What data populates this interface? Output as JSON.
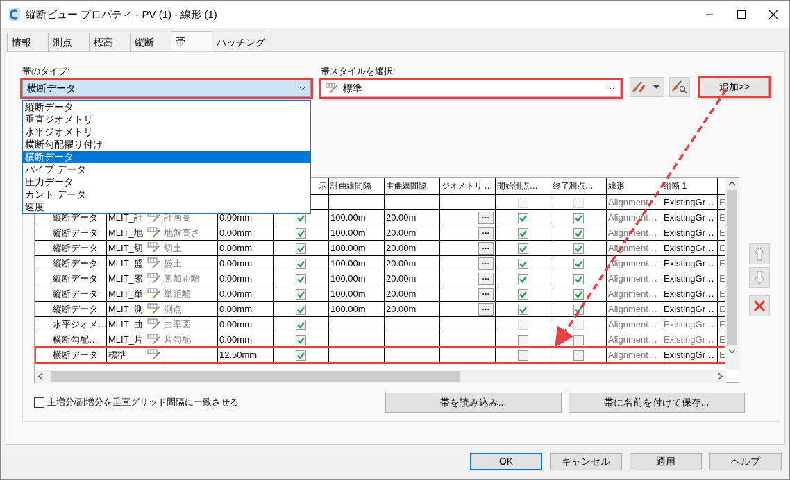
{
  "window": {
    "title": "縦断ビュー プロパティ - PV (1) - 線形 (1)"
  },
  "tabs": [
    {
      "label": "情報",
      "selected": false
    },
    {
      "label": "測点",
      "selected": false
    },
    {
      "label": "標高",
      "selected": false
    },
    {
      "label": "縦断",
      "selected": false
    },
    {
      "label": "帯",
      "selected": true
    },
    {
      "label": "ハッチング",
      "selected": false
    }
  ],
  "band_type": {
    "label": "帯のタイプ:",
    "value": "横断データ",
    "highlighted": true,
    "expanded": true,
    "options": [
      {
        "label": "縦断データ",
        "selected": false
      },
      {
        "label": "垂直ジオメトリ",
        "selected": false
      },
      {
        "label": "水平ジオメトリ",
        "selected": false
      },
      {
        "label": "横断勾配擢り付け",
        "selected": false
      },
      {
        "label": "横断データ",
        "selected": true
      },
      {
        "label": "パイプ データ",
        "selected": false
      },
      {
        "label": "圧力データ",
        "selected": false
      },
      {
        "label": "カント データ",
        "selected": false
      },
      {
        "label": "速度",
        "selected": false
      }
    ]
  },
  "band_style": {
    "label": "帯スタイルを選択:",
    "value": "標準",
    "highlighted": true
  },
  "add_button": {
    "label": "追加>>",
    "highlighted": true
  },
  "table": {
    "visible_columns": [
      "示",
      "計曲線間隔",
      "主曲線間隔",
      "ジオメトリ …",
      "開始測点…",
      "終了測点…",
      "線形",
      "縦断 1"
    ],
    "rows": [
      {
        "highlighted": false,
        "start": {
          "checked": false,
          "disabled": true
        },
        "end": {
          "checked": false,
          "disabled": true
        },
        "alignment": "Alignment…",
        "profile_1": "ExistingGr…",
        "profile_1_disabled": false,
        "column_13": "E"
      },
      {
        "highlighted": false,
        "type": "縦断データ",
        "style": "MLIT_計",
        "description": "計画高",
        "offset": "0.00mm",
        "visible": true,
        "major": "100.00m",
        "minor": "20.00m",
        "geometry_button": "···",
        "start": {
          "checked": true,
          "disabled": false
        },
        "end": {
          "checked": true,
          "disabled": false
        },
        "alignment": "Alignment…",
        "profile_1": "ExistingGr…",
        "profile_1_disabled": false,
        "column_13": "E"
      },
      {
        "highlighted": false,
        "type": "縦断データ",
        "style": "MLIT_地",
        "description": "地盤高さ",
        "offset": "0.00mm",
        "visible": true,
        "major": "100.00m",
        "minor": "20.00m",
        "geometry_button": "···",
        "start": {
          "checked": true,
          "disabled": false
        },
        "end": {
          "checked": true,
          "disabled": false
        },
        "alignment": "Alignment…",
        "profile_1": "ExistingGr…",
        "profile_1_disabled": false,
        "column_13": "E"
      },
      {
        "highlighted": false,
        "type": "縦断データ",
        "style": "MLIT_切",
        "description": "切土",
        "offset": "0.00mm",
        "visible": true,
        "major": "100.00m",
        "minor": "20.00m",
        "geometry_button": "···",
        "start": {
          "checked": true,
          "disabled": false
        },
        "end": {
          "checked": true,
          "disabled": false
        },
        "alignment": "Alignment…",
        "profile_1": "ExistingGr…",
        "profile_1_disabled": false,
        "column_13": "E"
      },
      {
        "highlighted": false,
        "type": "縦断データ",
        "style": "MLIT_盛",
        "description": "盛土",
        "offset": "0.00mm",
        "visible": true,
        "major": "100.00m",
        "minor": "20.00m",
        "geometry_button": "···",
        "start": {
          "checked": true,
          "disabled": false
        },
        "end": {
          "checked": true,
          "disabled": false
        },
        "alignment": "Alignment…",
        "profile_1": "ExistingGr…",
        "profile_1_disabled": false,
        "column_13": "E"
      },
      {
        "highlighted": false,
        "type": "縦断データ",
        "style": "MLIT_累",
        "description": "累加距離",
        "offset": "0.00mm",
        "visible": true,
        "major": "100.00m",
        "minor": "20.00m",
        "geometry_button": "···",
        "start": {
          "checked": true,
          "disabled": false
        },
        "end": {
          "checked": true,
          "disabled": false
        },
        "alignment": "Alignment…",
        "profile_1": "ExistingGr…",
        "profile_1_disabled": false,
        "column_13": "E"
      },
      {
        "highlighted": false,
        "type": "縦断データ",
        "style": "MLIT_単",
        "description": "単距離",
        "offset": "0.00mm",
        "visible": true,
        "major": "100.00m",
        "minor": "20.00m",
        "geometry_button": "···",
        "start": {
          "checked": true,
          "disabled": false
        },
        "end": {
          "checked": true,
          "disabled": false
        },
        "alignment": "Alignment…",
        "profile_1": "ExistingGr…",
        "profile_1_disabled": false,
        "column_13": "E"
      },
      {
        "highlighted": false,
        "type": "縦断データ",
        "style": "MLIT_測",
        "description": "測点",
        "offset": "0.00mm",
        "visible": true,
        "major": "100.00m",
        "minor": "20.00m",
        "geometry_button": "···",
        "start": {
          "checked": true,
          "disabled": false
        },
        "end": {
          "checked": true,
          "disabled": false
        },
        "alignment": "Alignment…",
        "profile_1": "ExistingGr…",
        "profile_1_disabled": false,
        "column_13": "E"
      },
      {
        "highlighted": false,
        "type": "水平ジオメ…",
        "style": "MLIT_曲",
        "description": "曲率図",
        "offset": "0.00mm",
        "visible": true,
        "start": {
          "checked": false,
          "disabled": true
        },
        "end": {
          "checked": false,
          "disabled": true
        },
        "alignment": "Alignment…",
        "profile_1": "ExistingGr…",
        "profile_1_disabled": true,
        "column_13": "E"
      },
      {
        "highlighted": false,
        "type": "横断勾配…",
        "style": "MLIT_片",
        "description": "片勾配",
        "offset": "0.00mm",
        "visible": true,
        "start": {
          "checked": false,
          "disabled": false
        },
        "end": {
          "checked": false,
          "disabled": false
        },
        "alignment": "Alignment…",
        "profile_1": "ExistingGr…",
        "profile_1_disabled": true,
        "column_13": "E"
      },
      {
        "highlighted": true,
        "type": "横断データ",
        "style": "標準",
        "offset": "12.50mm",
        "visible": true,
        "start": {
          "checked": false,
          "disabled": false
        },
        "end": {
          "checked": false,
          "disabled": false
        },
        "alignment": "Alignment…",
        "profile_1": "ExistingGr…",
        "profile_1_disabled": false,
        "column_13": "E"
      }
    ]
  },
  "match_grid": {
    "label": "主増分/副増分を垂直グリッド間隔に一致させる",
    "checked": false
  },
  "band_buttons": [
    "帯を読み込み...",
    "帯に名前を付けて保存..."
  ],
  "footer_buttons": [
    {
      "label": "OK",
      "default": true
    },
    {
      "label": "キャンセル",
      "default": false
    },
    {
      "label": "適用",
      "default": false
    },
    {
      "label": "ヘルプ",
      "default": false
    }
  ]
}
